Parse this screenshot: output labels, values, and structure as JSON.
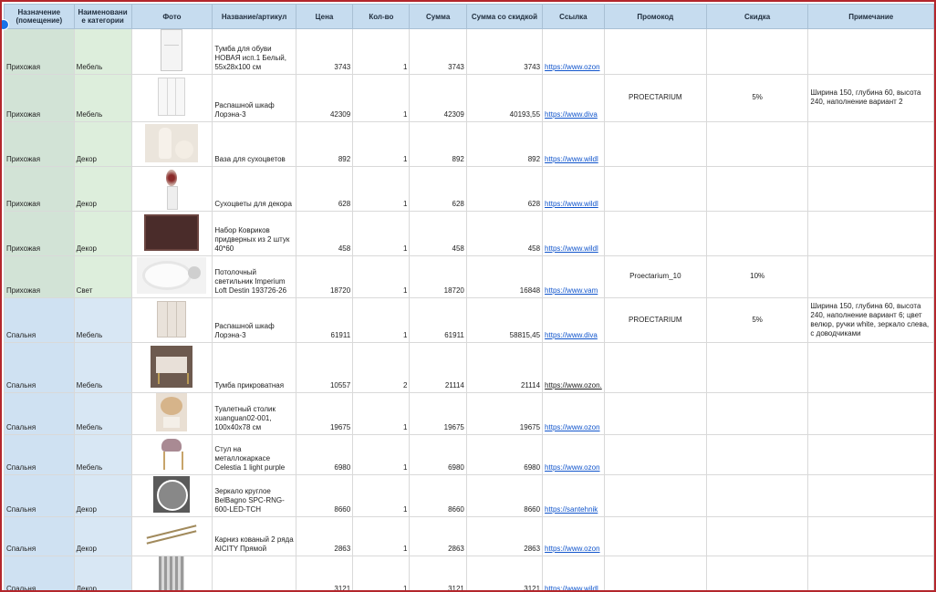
{
  "headers": {
    "room": "Назначение (помещение)",
    "category": "Наименовани е категории",
    "photo": "Фото",
    "name": "Название/артикул",
    "price": "Цена",
    "qty": "Кол-во",
    "sum": "Сумма",
    "sum_discount": "Сумма со скидкой",
    "link": "Ссылка",
    "promo": "Промокод",
    "discount": "Скидка",
    "note": "Примечание"
  },
  "rows": [
    {
      "room": "Прихожая",
      "category": "Мебель",
      "photo_icon": "shoe-cabinet-icon",
      "name": "Тумба для обуви НОВАЯ исп.1 Белый, 55х28х100 см",
      "price": "3743",
      "qty": "1",
      "sum": "3743",
      "sum_discount": "3743",
      "link": "https://www.ozon",
      "promo": "",
      "discount": "",
      "note": ""
    },
    {
      "room": "Прихожая",
      "category": "Мебель",
      "photo_icon": "wardrobe-icon",
      "name": "Распашной шкаф Лорэна-3",
      "price": "42309",
      "qty": "1",
      "sum": "42309",
      "sum_discount": "40193,55",
      "link": "https://www.diva",
      "promo": "PROECTARIUM",
      "discount": "5%",
      "note": "Ширина 150, глубина 60, высота 240, наполнение вариант 2"
    },
    {
      "room": "Прихожая",
      "category": "Декор",
      "photo_icon": "vase-icon",
      "name": "Ваза для сухоцветов",
      "price": "892",
      "qty": "1",
      "sum": "892",
      "sum_discount": "892",
      "link": "https://www.wildl",
      "promo": "",
      "discount": "",
      "note": ""
    },
    {
      "room": "Прихожая",
      "category": "Декор",
      "photo_icon": "dried-flowers-icon",
      "name": "Сухоцветы для декора",
      "price": "628",
      "qty": "1",
      "sum": "628",
      "sum_discount": "628",
      "link": "https://www.wildl",
      "promo": "",
      "discount": "",
      "note": ""
    },
    {
      "room": "Прихожая",
      "category": "Декор",
      "photo_icon": "doormat-icon",
      "name": "Набор Ковриков придверных из 2 штук 40*60",
      "price": "458",
      "qty": "1",
      "sum": "458",
      "sum_discount": "458",
      "link": "https://www.wildl",
      "promo": "",
      "discount": "",
      "note": ""
    },
    {
      "room": "Прихожая",
      "category": "Свет",
      "photo_icon": "ceiling-lamp-icon",
      "name": "Потолочный светильник Imperium Loft Destin 193726-26",
      "price": "18720",
      "qty": "1",
      "sum": "18720",
      "sum_discount": "16848",
      "link": "https://www.vam",
      "promo": "Proectarium_10",
      "discount": "10%",
      "note": ""
    },
    {
      "room": "Спальня",
      "category": "Мебель",
      "photo_icon": "wardrobe-icon",
      "name": "Распашной шкаф Лорэна-3",
      "price": "61911",
      "qty": "1",
      "sum": "61911",
      "sum_discount": "58815,45",
      "link": "https://www.diva",
      "promo": "PROECTARIUM",
      "discount": "5%",
      "note": "Ширина 150, глубина 60, высота 240, наполнение вариант 6; цвет велюр, ручки white, зеркало слева, с доводчиками"
    },
    {
      "room": "Спальня",
      "category": "Мебель",
      "photo_icon": "nightstand-icon",
      "name": "Тумба прикроватная",
      "price": "10557",
      "qty": "2",
      "sum": "21114",
      "sum_discount": "21114",
      "link": "https://www.ozon.",
      "promo": "",
      "discount": "",
      "note": ""
    },
    {
      "room": "Спальня",
      "category": "Мебель",
      "photo_icon": "dressing-table-icon",
      "name": "Туалетный столик xuanguan02-001, 100х40х78 см",
      "price": "19675",
      "qty": "1",
      "sum": "19675",
      "sum_discount": "19675",
      "link": "https://www.ozon",
      "promo": "",
      "discount": "",
      "note": ""
    },
    {
      "room": "Спальня",
      "category": "Мебель",
      "photo_icon": "chair-icon",
      "name": "Стул на металлокаркасе Celestia 1 light purple",
      "price": "6980",
      "qty": "1",
      "sum": "6980",
      "sum_discount": "6980",
      "link": "https://www.ozon",
      "promo": "",
      "discount": "",
      "note": ""
    },
    {
      "room": "Спальня",
      "category": "Декор",
      "photo_icon": "round-mirror-icon",
      "name": "Зеркало круглое BelBagno SPC-RNG-600-LED-TCH",
      "price": "8660",
      "qty": "1",
      "sum": "8660",
      "sum_discount": "8660",
      "link": "https://santehnik",
      "promo": "",
      "discount": "",
      "note": ""
    },
    {
      "room": "Спальня",
      "category": "Декор",
      "photo_icon": "curtain-rod-icon",
      "name": "Карниз кованый 2 ряда AICITY Прямой",
      "price": "2863",
      "qty": "1",
      "sum": "2863",
      "sum_discount": "2863",
      "link": "https://www.ozon",
      "promo": "",
      "discount": "",
      "note": ""
    },
    {
      "room": "Спальня",
      "category": "Декор",
      "photo_icon": "curtain-icon",
      "name": "",
      "price": "3121",
      "qty": "1",
      "sum": "3121",
      "sum_discount": "3121",
      "link": "https://www.wildl",
      "promo": "",
      "discount": "",
      "note": ""
    }
  ],
  "colors": {
    "frame_border": "#b3262c",
    "header_bg": "#c6dcef",
    "room_col_hallway": "#d2e3d6",
    "room_col_bedroom": "#cfe1f2",
    "link": "#1155cc",
    "selection_dot": "#1a73e8"
  }
}
